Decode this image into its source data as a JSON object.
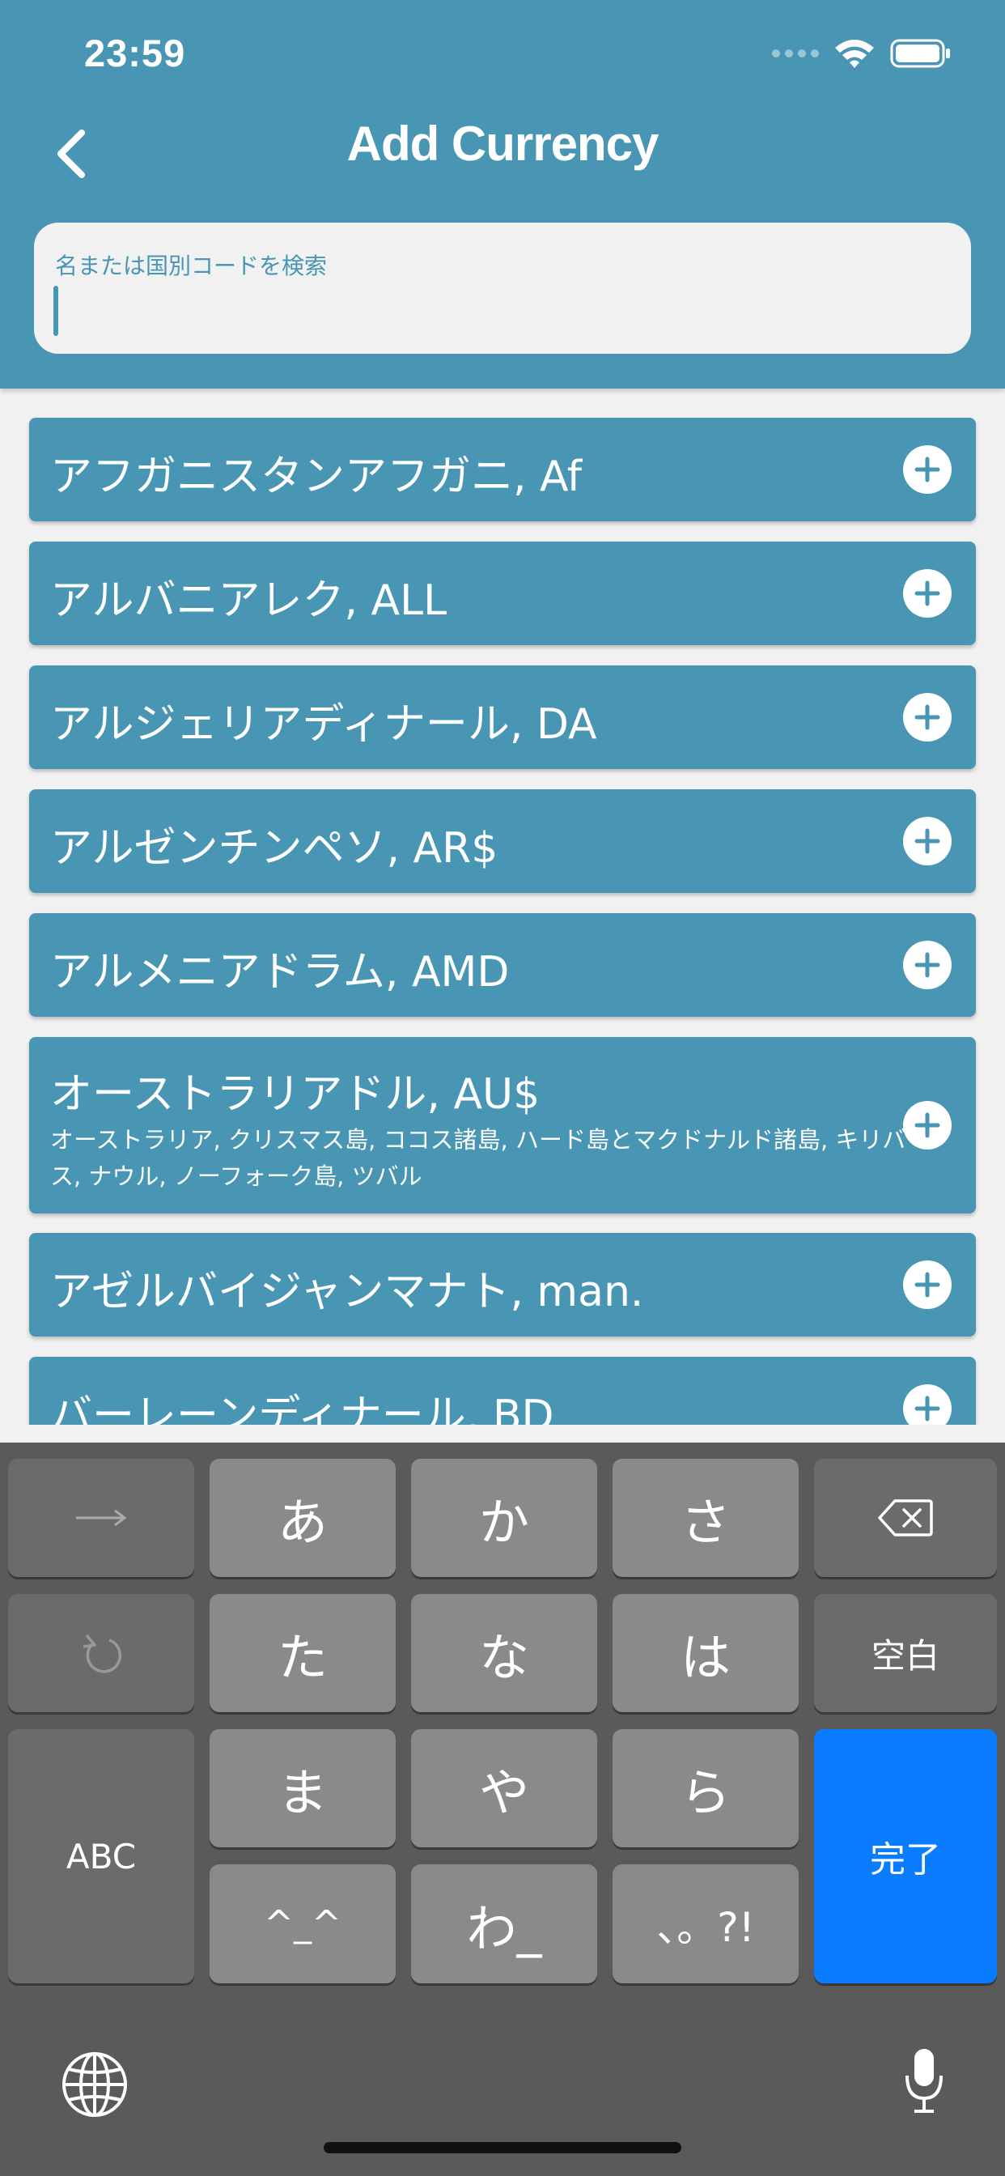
{
  "status_bar": {
    "time": "23:59"
  },
  "header": {
    "title": "Add Currency",
    "back_icon": "chevron-left-icon"
  },
  "search": {
    "label": "名または国別コードを検索",
    "value": ""
  },
  "currencies": [
    {
      "name": "アフガニスタンアフガニ, Af",
      "countries": ""
    },
    {
      "name": "アルバニアレク, ALL",
      "countries": ""
    },
    {
      "name": "アルジェリアディナール, DA",
      "countries": ""
    },
    {
      "name": "アルゼンチンペソ, AR$",
      "countries": ""
    },
    {
      "name": "アルメニアドラム, AMD",
      "countries": ""
    },
    {
      "name": "オーストラリアドル, AU$",
      "countries": "オーストラリア, クリスマス島, ココス諸島, ハード島とマクドナルド諸島, キリバス, ナウル, ノーフォーク島, ツバル"
    },
    {
      "name": "アゼルバイジャンマナト, man.",
      "countries": ""
    },
    {
      "name": "バーレーンディナール, BD",
      "countries": ""
    }
  ],
  "keyboard": {
    "row1": [
      "→",
      "あ",
      "か",
      "さ",
      "⌫"
    ],
    "row2": [
      "↺",
      "た",
      "な",
      "は",
      "空白"
    ],
    "row3": [
      "ABC",
      "ま",
      "や",
      "ら",
      "完了"
    ],
    "row4": [
      "^_^",
      "わ_",
      "、。?!"
    ],
    "done_color": "#0a7dff"
  },
  "colors": {
    "accent": "#4896b3",
    "background": "#f1f1f1"
  }
}
